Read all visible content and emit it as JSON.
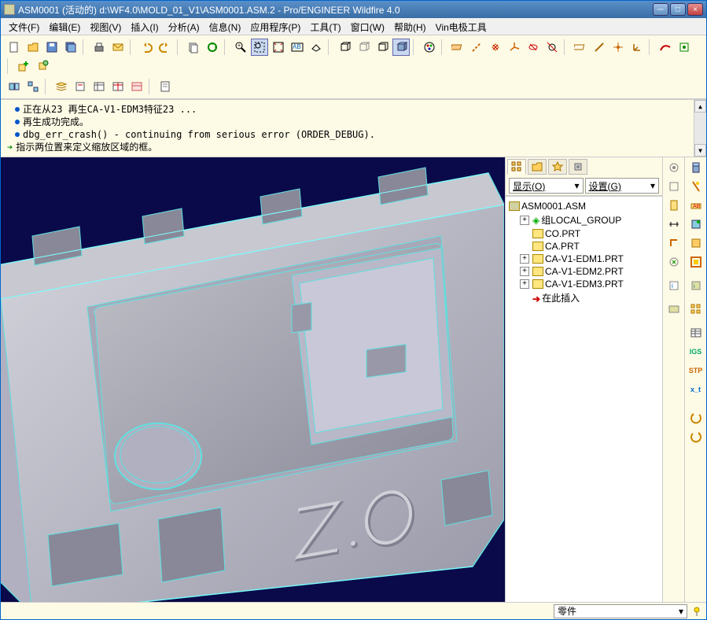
{
  "titlebar": {
    "text": "ASM0001 (活动的) d:\\WF4.0\\MOLD_01_V1\\ASM0001.ASM.2 - Pro/ENGINEER Wildfire 4.0"
  },
  "menubar": {
    "file": "文件(F)",
    "edit": "编辑(E)",
    "view": "视图(V)",
    "insert": "插入(I)",
    "analysis": "分析(A)",
    "info": "信息(N)",
    "apps": "应用程序(P)",
    "tools": "工具(T)",
    "window": "窗口(W)",
    "help": "帮助(H)",
    "vin": "Vin电极工具"
  },
  "messages": {
    "m1": "正在从23 再生CA-V1-EDM3特征23 ...",
    "m2": "再生成功完成。",
    "m3": " dbg_err_crash() - continuing from serious error (ORDER_DEBUG).",
    "m4": "指示两位置来定义缩放区域的框。"
  },
  "panel": {
    "show_label": "显示(O)",
    "settings_label": "设置(G)"
  },
  "tree": {
    "root": "ASM0001.ASM",
    "n1": "组LOCAL_GROUP",
    "n2": "CO.PRT",
    "n3": "CA.PRT",
    "n4": "CA-V1-EDM1.PRT",
    "n5": "CA-V1-EDM2.PRT",
    "n6": "CA-V1-EDM3.PRT",
    "n7": "在此插入"
  },
  "status": {
    "combo": "零件"
  },
  "icons": {
    "igs": "IGS",
    "stp": "STP",
    "xt": "x_t"
  }
}
